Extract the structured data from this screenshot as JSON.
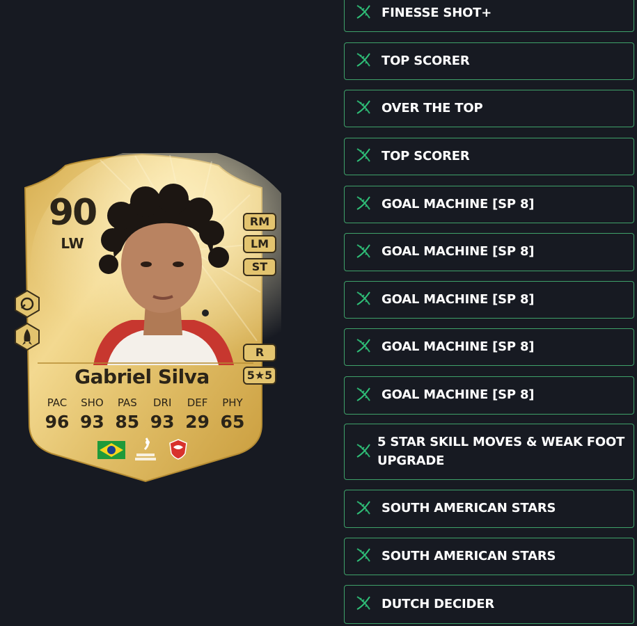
{
  "card": {
    "rating": "90",
    "position": "LW",
    "alt_positions": [
      "RM",
      "LM",
      "ST"
    ],
    "preferred_foot": "R",
    "skill_weak_foot": "5★5",
    "name": "Gabriel Silva",
    "stats": [
      {
        "label": "PAC",
        "value": "96"
      },
      {
        "label": "SHO",
        "value": "93"
      },
      {
        "label": "PAS",
        "value": "85"
      },
      {
        "label": "DRI",
        "value": "93"
      },
      {
        "label": "DEF",
        "value": "29"
      },
      {
        "label": "PHY",
        "value": "65"
      }
    ],
    "nation_icon": "brazil-flag-icon",
    "league_icon": "liga-portugal-logo",
    "club_icon": "club-crest-icon",
    "playstyle_icons": [
      "finesse-shot-icon",
      "power-shot-icon"
    ],
    "accent_gold": "#e2c36e"
  },
  "playstyles": [
    "FINESSE SHOT+",
    "TOP SCORER",
    "OVER THE TOP",
    "TOP SCORER",
    "GOAL MACHINE [SP 8]",
    "GOAL MACHINE [SP 8]",
    "GOAL MACHINE [SP 8]",
    "GOAL MACHINE [SP 8]",
    "GOAL MACHINE [SP 8]",
    "5 STAR SKILL MOVES & WEAK FOOT UPGRADE",
    "SOUTH AMERICAN STARS",
    "SOUTH AMERICAN STARS",
    "DUTCH DECIDER"
  ],
  "colors": {
    "background": "#171a22",
    "item_border": "#3fa26a",
    "dna_icon": "#2fbf78"
  }
}
